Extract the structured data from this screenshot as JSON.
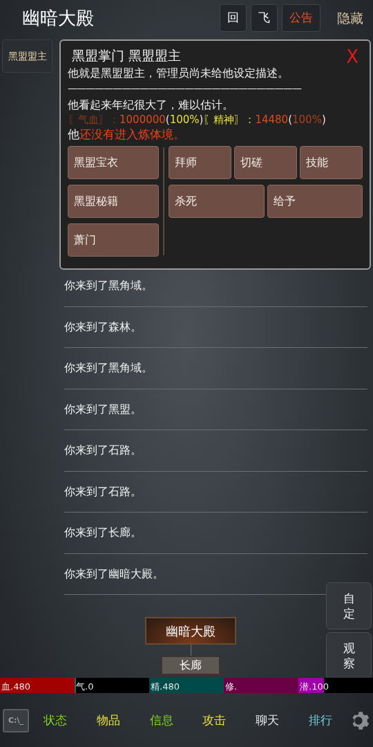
{
  "header": {
    "title": "幽暗大殿",
    "buttons": [
      {
        "label": "回",
        "kind": "plain"
      },
      {
        "label": "飞",
        "kind": "plain"
      },
      {
        "label": "公告",
        "kind": "alert"
      }
    ],
    "hide": "隐藏"
  },
  "npc_tab": "黑盟盟主",
  "popup": {
    "title": "黑盟掌门 黑盟盟主",
    "close": "X",
    "description": "他就是黑盟盟主，管理员尚未给他设定描述。",
    "separator": "——————————————————————————",
    "age": "他看起来年纪很大了，难以估计。",
    "stats": [
      {
        "text": "〖气血〗：",
        "color": "#8a3a1a"
      },
      {
        "text": "1000000",
        "color": "#e04a1a"
      },
      {
        "text": "(",
        "color": "#e8e8e8"
      },
      {
        "text": "100%",
        "color": "#e8e03a"
      },
      {
        "text": ")",
        "color": "#e8e8e8"
      },
      {
        "text": "〖精神〗：",
        "color": "#e8e03a"
      },
      {
        "text": "14480",
        "color": "#e04a1a"
      },
      {
        "text": "(",
        "color": "#e8e8e8"
      },
      {
        "text": "100%",
        "color": "#b0401a"
      },
      {
        "text": ")",
        "color": "#e8e8e8"
      }
    ],
    "realm_prefix": "他",
    "realm": "还没有进入炼体境。",
    "items": [
      "黑盟宝衣",
      "黑盟秘籍",
      "萧门"
    ],
    "actions": [
      [
        "拜师",
        "切磋",
        "技能"
      ],
      [
        "杀死",
        "给予"
      ]
    ]
  },
  "log": [
    "你来到了黑角域。",
    "你来到了森林。",
    "你来到了黑角域。",
    "你来到了黑盟。",
    "你来到了石路。",
    "你来到了石路。",
    "你来到了长廊。",
    "你来到了幽暗大殿。"
  ],
  "side_buttons": [
    "自定",
    "观察"
  ],
  "map": {
    "current": "幽暗大殿",
    "exit": "长廊"
  },
  "bars": [
    {
      "label": "血.480",
      "color": "#a30000",
      "level": 1
    },
    {
      "label": "气.0",
      "color": "#1a6a6a",
      "level": 0
    },
    {
      "label": "精.480",
      "color": "#004a4a",
      "level": 1
    },
    {
      "label": "修.",
      "color": "#6a0046",
      "level": 1
    },
    {
      "label": "潜.100",
      "color": "#a000a8",
      "level": 0.33
    }
  ],
  "console": "C:\\_",
  "nav": [
    {
      "label": "状态",
      "color": "#7ed321"
    },
    {
      "label": "物品",
      "color": "#e6e13a"
    },
    {
      "label": "信息",
      "color": "#7ed321"
    },
    {
      "label": "攻击",
      "color": "#e6e13a"
    },
    {
      "label": "聊天",
      "color": "#e8e8e8"
    },
    {
      "label": "排行",
      "color": "#6fd0e0"
    }
  ]
}
